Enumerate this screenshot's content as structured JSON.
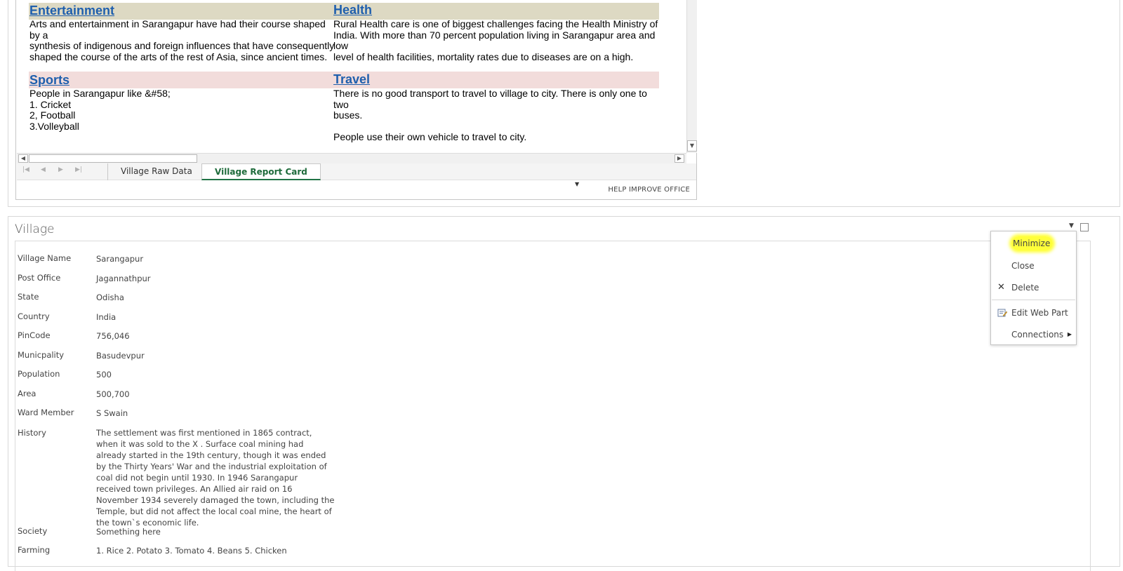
{
  "excel": {
    "cells": {
      "entertainment_title": "Entertainment",
      "entertainment_text": "Arts and entertainment in Sarangapur have had their course shaped by a\nsynthesis of indigenous and foreign influences that have consequently\nshaped the course of the arts of the rest of Asia, since ancient times.",
      "health_title": "Health",
      "health_text": "Rural Health care is one of biggest challenges facing the Health Ministry of\nIndia. With more than 70 percent population living in Sarangapur area and low\nlevel of health facilities, mortality rates due to diseases are on a high.",
      "sports_title": "Sports",
      "sports_text": "People in Sarangapur like &#58;\n1. Cricket\n2, Football\n3.Volleyball",
      "travel_title": "Travel",
      "travel_text": "There is no good transport to travel to village to city. There is only one to two\nbuses.\n\nPeople use their own vehicle to travel to city."
    },
    "tabs": [
      "Village Raw Data",
      "Village Report Card"
    ],
    "active_tab": "Village Report Card",
    "status": {
      "help": "HELP IMPROVE OFFICE"
    }
  },
  "village_webpart": {
    "title": "Village",
    "fields": [
      {
        "label": "Village Name",
        "value": "Sarangapur"
      },
      {
        "label": "Post Office",
        "value": "Jagannathpur"
      },
      {
        "label": "State",
        "value": "Odisha"
      },
      {
        "label": "Country",
        "value": "India"
      },
      {
        "label": "PinCode",
        "value": "756,046"
      },
      {
        "label": "Municpality",
        "value": "Basudevpur"
      },
      {
        "label": "Population",
        "value": "500"
      },
      {
        "label": "Area",
        "value": "500,700"
      },
      {
        "label": "Ward Member",
        "value": "S Swain"
      },
      {
        "label": "History",
        "value": "The settlement was first mentioned in 1865 contract, when it was sold to the X . Surface coal mining had already started in the 19th century, though it was ended by the Thirty Years' War and the industrial exploitation of coal did not begin until 1930. In 1946 Sarangapur received town privileges. An Allied air raid on 16 November 1934 severely damaged the town, including the Temple, but did not affect the local coal mine, the heart of the town`s economic life."
      },
      {
        "label": "Society",
        "value": "Something here"
      },
      {
        "label": "Farming",
        "value": "1. Rice 2. Potato 3. Tomato 4. Beans 5. Chicken"
      }
    ]
  },
  "context_menu": {
    "items": {
      "minimize": "Minimize",
      "close": "Close",
      "delete": "Delete",
      "edit_web_part": "Edit Web Part",
      "connections": "Connections"
    },
    "highlight_color": "#ffff3a"
  },
  "colors": {
    "title_link": "#1f5fad",
    "band_tan": "#ddd9c3",
    "band_pink": "#f2dcdb",
    "active_tab": "#217346"
  }
}
